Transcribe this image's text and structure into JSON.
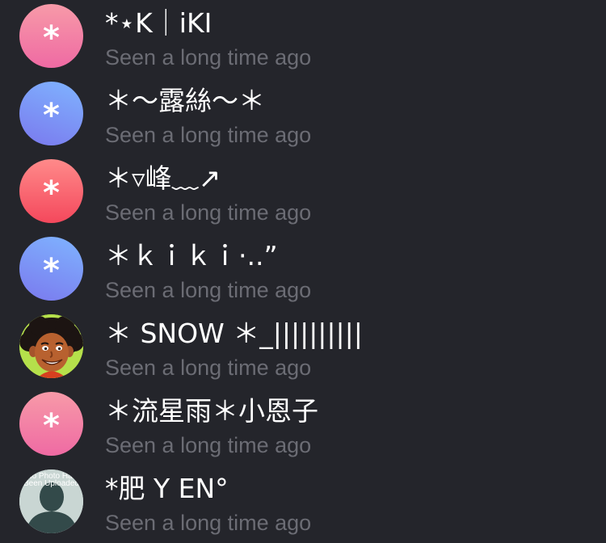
{
  "contacts": [
    {
      "name": "*⋆K｜iKI",
      "status": "Seen a long time ago",
      "avatar": {
        "type": "initial",
        "glyph": "*",
        "color": "pink"
      }
    },
    {
      "name": "＊～露絲～＊",
      "status": "Seen a long time ago",
      "avatar": {
        "type": "initial",
        "glyph": "*",
        "color": "blue"
      }
    },
    {
      "name": "＊▿峰﹏↗",
      "status": "Seen a long time ago",
      "avatar": {
        "type": "initial",
        "glyph": "*",
        "color": "red"
      }
    },
    {
      "name": "＊ｋｉｋｉ·..”",
      "status": "Seen a long time ago",
      "avatar": {
        "type": "initial",
        "glyph": "*",
        "color": "blue"
      }
    },
    {
      "name": "＊ SNOW ＊_||||||||||",
      "status": "Seen a long time ago",
      "avatar": {
        "type": "photo",
        "icon": "cartoon-face"
      }
    },
    {
      "name": "＊流星雨＊小恩子",
      "status": "Seen a long time ago",
      "avatar": {
        "type": "initial",
        "glyph": "*",
        "color": "pink"
      }
    },
    {
      "name": "*肥 Y EN°",
      "status": "Seen a long time ago",
      "avatar": {
        "type": "photo",
        "icon": "no-photo-placeholder",
        "text": "No Photo Has Been Uploaded"
      }
    }
  ],
  "colors": {
    "background": "#24252b",
    "name_text": "#ffffff",
    "status_text": "#6b6c74",
    "pink_gradient": [
      "#f79aa8",
      "#ef6aa3"
    ],
    "blue_gradient": [
      "#7fb4ff",
      "#7a79ee"
    ],
    "red_gradient": [
      "#ff8a8a",
      "#f4485c"
    ]
  }
}
